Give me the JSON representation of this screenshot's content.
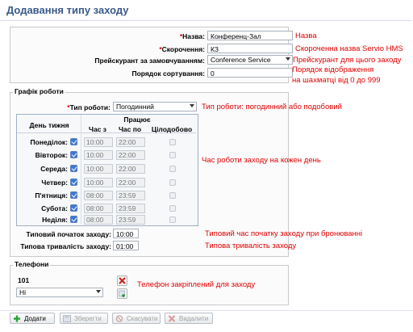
{
  "window": {
    "title": "Додавання типу заходу"
  },
  "main_form": {
    "name": {
      "label": "Назва:",
      "value": "Конференц-Зал",
      "note": "Назва"
    },
    "short": {
      "label": "Скорочення:",
      "value": "КЗ",
      "note": "Скороченна назва Servio HMS"
    },
    "pricelist": {
      "label": "Прейскурант за замовчуванням:",
      "value": "Conference Service",
      "note": "Прейскурант для цього заходу"
    },
    "sort_order": {
      "label": "Порядок сортування:",
      "value": "0",
      "note_line1": "Порядок відображення",
      "note_line2": "на шахматці від 0 до 999"
    }
  },
  "schedule": {
    "legend": "Графік роботи",
    "work_type": {
      "label": "Тип роботи:",
      "value": "Погодинний",
      "note": "Тип роботи: погодинний або подобовий"
    },
    "table": {
      "header_day": "День тижня",
      "header_working": "Працює",
      "header_from": "Час з",
      "header_to": "Час по",
      "header_allday": "Цілодобово",
      "rows": [
        {
          "day": "Понеділок:",
          "from": "10:00",
          "to": "22:00"
        },
        {
          "day": "Вівторок:",
          "from": "10:00",
          "to": "22:00"
        },
        {
          "day": "Середа:",
          "from": "10:00",
          "to": "22:00"
        },
        {
          "day": "Четвер:",
          "from": "10:00",
          "to": "22:00"
        },
        {
          "day": "П'ятниця:",
          "from": "08:00",
          "to": "23:59"
        },
        {
          "day": "Субота:",
          "from": "08:00",
          "to": "23:59"
        },
        {
          "day": "Неділя:",
          "from": "08:00",
          "to": "23:59"
        }
      ],
      "note": "Час роботи заходу на кожен день"
    },
    "typical_start": {
      "label": "Типовий початок заходу:",
      "value": "10:00",
      "note": "Типовий час початку заходу при бронюванні"
    },
    "typical_duration": {
      "label": "Типова тривалість заходу:",
      "value": "01:00",
      "note": "Типова тривалість заходу"
    }
  },
  "phones": {
    "legend": "Телефони",
    "number": "101",
    "select_value": "Hi",
    "note": "Телефон закріплений для заходу"
  },
  "toolbar": {
    "add": "Додати",
    "save": "Зберегти",
    "cancel": "Скасувати",
    "delete": "Видалити"
  }
}
